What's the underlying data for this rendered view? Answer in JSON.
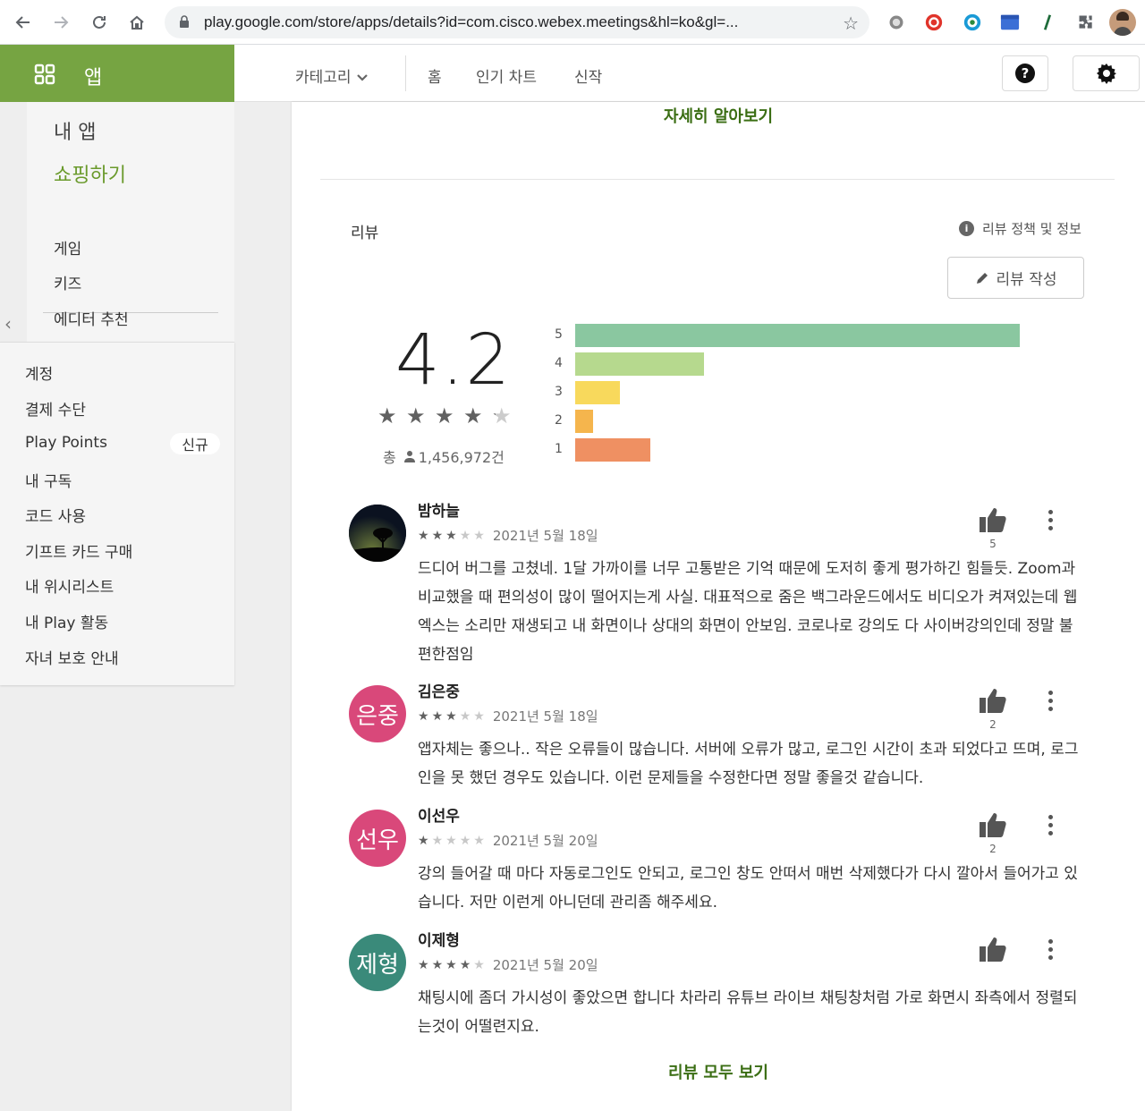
{
  "browser": {
    "url": "play.google.com/store/apps/details?id=com.cisco.webex.meetings&hl=ko&gl=...",
    "icons": [
      "back-icon",
      "forward-icon",
      "reload-icon",
      "home-icon",
      "lock-icon",
      "bookmark-star-icon",
      "extensions-icon"
    ]
  },
  "header": {
    "apps_label": "앱",
    "tabs": [
      "카테고리",
      "홈",
      "인기 차트",
      "신작"
    ],
    "accent_color": "#76a442"
  },
  "sidebar": {
    "my_apps": "내 앱",
    "shopping": "쇼핑하기",
    "sub_items": [
      "게임",
      "키즈",
      "에디터 추천"
    ],
    "account_items": [
      "계정",
      "결제 수단",
      "Play Points",
      "내 구독",
      "코드 사용",
      "기프트 카드 구매",
      "내 위시리스트",
      "내 Play 활동",
      "자녀 보호 안내"
    ],
    "new_badge": "신규"
  },
  "main": {
    "learn_more": "자세히 알아보기",
    "reviews_title": "리뷰",
    "policy_label": "리뷰 정책 및 정보",
    "write_review": "리뷰 작성",
    "rating": "4.2",
    "rating_value": 4.2,
    "total_prefix": "총",
    "total_count": "1,456,972건",
    "see_all": "리뷰 모두 보기"
  },
  "chart_data": {
    "type": "bar",
    "categories": [
      "5",
      "4",
      "3",
      "2",
      "1"
    ],
    "values": [
      1000,
      290,
      100,
      40,
      170
    ],
    "colors": [
      "#8ac7a0",
      "#b6d98e",
      "#f8d95c",
      "#f5b54d",
      "#ef9062"
    ]
  },
  "reviews": [
    {
      "name": "밤하늘",
      "stars": 3,
      "date": "2021년 5월 18일",
      "likes": "5",
      "avatar_text": "",
      "avatar_color": "#0b1220",
      "body": "드디어 버그를 고쳤네. 1달 가까이를 너무 고통받은 기억 때문에 도저히 좋게 평가하긴 힘들듯. Zoom과 비교했을 때 편의성이 많이 떨어지는게 사실. 대표적으로 줌은 백그라운드에서도 비디오가 켜져있는데 웹엑스는 소리만 재생되고 내 화면이나 상대의 화면이 안보임. 코로나로 강의도 다 사이버강의인데 정말 불편한점임"
    },
    {
      "name": "김은중",
      "stars": 3,
      "date": "2021년 5월 18일",
      "likes": "2",
      "avatar_text": "은중",
      "avatar_color": "#d9487a",
      "body": "앱자체는 좋으나.. 작은 오류들이 많습니다. 서버에 오류가 많고, 로그인 시간이 초과 되었다고 뜨며, 로그인을 못 했던 경우도 있습니다. 이런 문제들을 수정한다면 정말 좋을것 같습니다."
    },
    {
      "name": "이선우",
      "stars": 1,
      "date": "2021년 5월 20일",
      "likes": "2",
      "avatar_text": "선우",
      "avatar_color": "#d9487a",
      "body": "강의 들어갈 때 마다 자동로그인도 안되고, 로그인 창도 안떠서 매번 삭제했다가 다시 깔아서 들어가고 있습니다. 저만 이런게 아니던데 관리좀 해주세요."
    },
    {
      "name": "이제형",
      "stars": 4,
      "date": "2021년 5월 20일",
      "likes": "",
      "avatar_text": "제형",
      "avatar_color": "#3a8a7a",
      "body": "채팅시에 좀더 가시성이 좋았으면 합니다 차라리 유튜브 라이브 채팅창처럼 가로 화면시 좌측에서 정렬되는것이 어떨련지요."
    }
  ]
}
